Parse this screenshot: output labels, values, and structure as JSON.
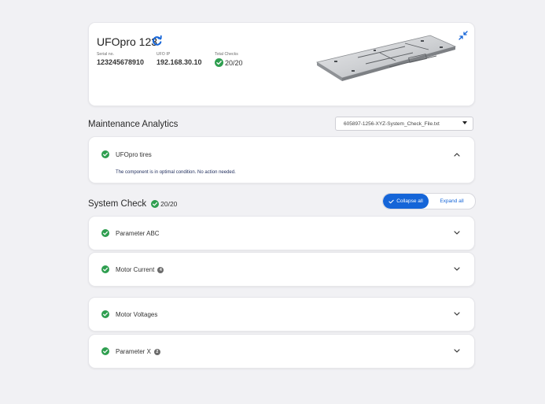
{
  "device": {
    "name": "UFOpro 123",
    "serial_label": "Serial no.",
    "serial_value": "123245678910",
    "ip_label": "UFO IP",
    "ip_value": "192.168.30.10",
    "checks_label": "Total Checks",
    "checks_value": "20/20"
  },
  "maintenance": {
    "title": "Maintenance Analytics",
    "file_select": "605897-1256-XYZ-System_Check_File.txt",
    "item": {
      "label": "UFOpro tires",
      "note": "The component is in optimal condition. No action needed."
    }
  },
  "system_check": {
    "title": "System Check",
    "count": "20/20",
    "collapse_label": "Collapse all",
    "expand_label": "Expand all",
    "items": [
      {
        "label": "Parameter ABC",
        "badge": ""
      },
      {
        "label": "Motor Current",
        "badge": "4"
      },
      {
        "label": "Motor Voltages",
        "badge": ""
      },
      {
        "label": "Parameter X",
        "badge": "2"
      }
    ]
  },
  "colors": {
    "accent": "#1565d8",
    "success": "#2e9e4f",
    "background": "#f1f1f4"
  },
  "icons": {
    "refresh": "refresh-icon",
    "collapse_corner": "collapse-arrows-icon",
    "check": "check-circle-icon",
    "chevron_up": "chevron-up-icon",
    "chevron_down": "chevron-down-icon"
  }
}
